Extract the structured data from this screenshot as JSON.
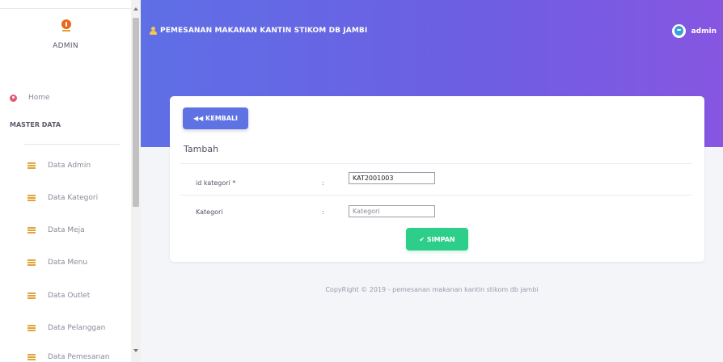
{
  "sidebar": {
    "role_label": "ADMIN",
    "home_label": "Home",
    "section_label": "MASTER DATA",
    "items": [
      {
        "label": "Data Admin"
      },
      {
        "label": "Data Kategori"
      },
      {
        "label": "Data Meja"
      },
      {
        "label": "Data Menu"
      },
      {
        "label": "Data Outlet"
      },
      {
        "label": "Data Pelanggan"
      },
      {
        "label": "Data Pemesanan"
      }
    ]
  },
  "header": {
    "title": "PEMESANAN MAKANAN KANTIN STIKOM DB JAMBI",
    "user_name": "admin"
  },
  "form": {
    "back_label": "◀◀ KEMBALI",
    "title": "Tambah",
    "fields": [
      {
        "label": "id kategori *",
        "value": "KAT2001003",
        "placeholder": ""
      },
      {
        "label": "Kategori",
        "value": "",
        "placeholder": "Kategori"
      }
    ],
    "colon": ":",
    "save_label": "✔ SIMPAN"
  },
  "footer": {
    "text": "CopyRight © 2019 - pemesanan makanan kantin stikom db jambi"
  },
  "colors": {
    "primary": "#5e72e4",
    "success": "#2dce89",
    "header_gradient_start": "#5f6fe6",
    "header_gradient_end": "#8656e1",
    "icon_accent": "#e0a43a"
  }
}
